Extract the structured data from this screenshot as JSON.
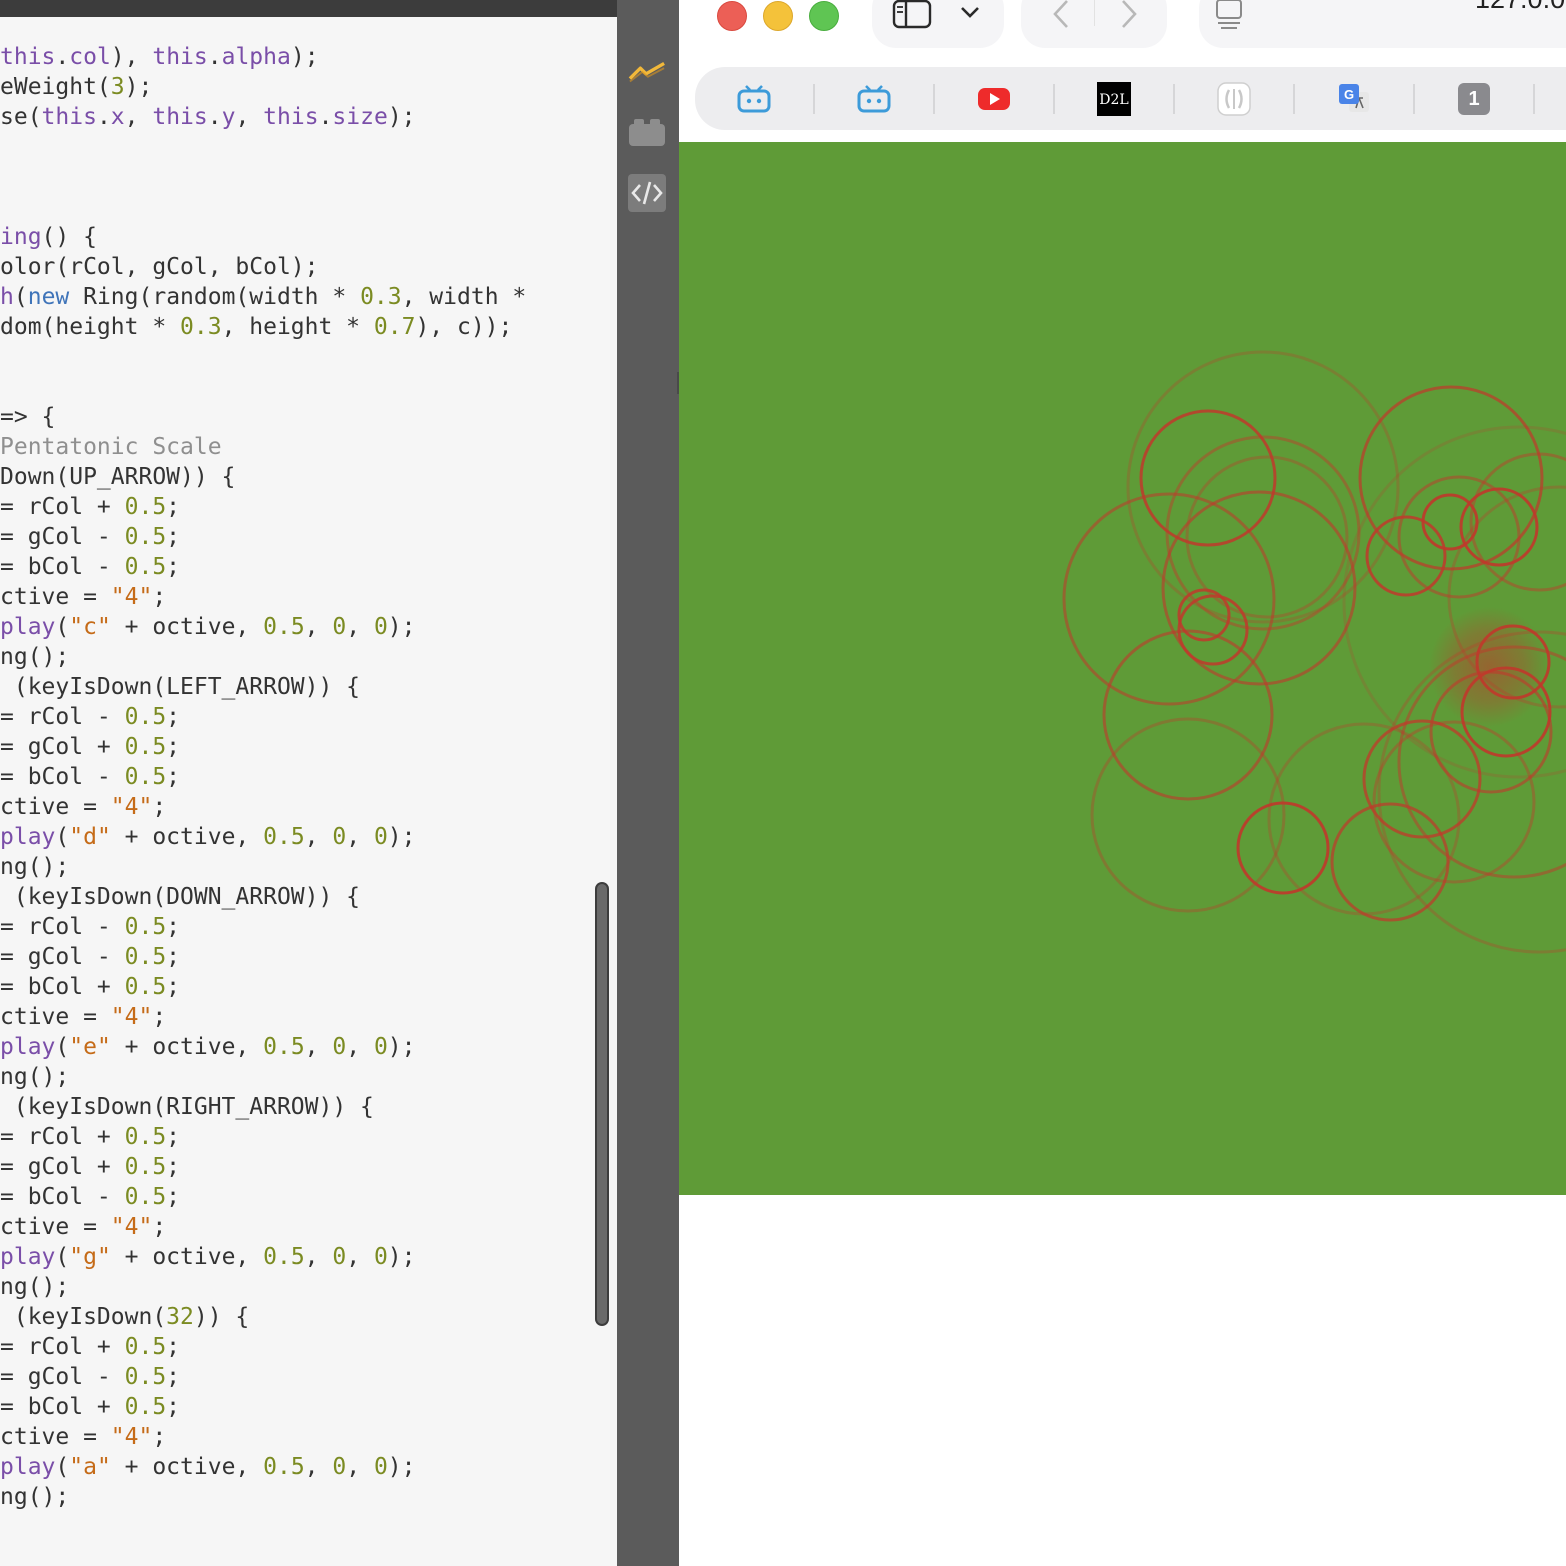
{
  "editor": {
    "lines": [
      {
        "tokens": [
          [
            "",
            ""
          ]
        ]
      },
      {
        "tokens": [
          [
            "prop",
            "this"
          ],
          [
            "",
            "."
          ],
          [
            "prop",
            "col"
          ],
          [
            "",
            "), "
          ],
          [
            "prop",
            "this"
          ],
          [
            "",
            "."
          ],
          [
            "prop",
            "alpha"
          ],
          [
            "",
            ");"
          ]
        ]
      },
      {
        "tokens": [
          [
            "",
            "eWeight("
          ],
          [
            "num",
            "3"
          ],
          [
            "",
            ");"
          ]
        ]
      },
      {
        "tokens": [
          [
            "",
            "se("
          ],
          [
            "prop",
            "this"
          ],
          [
            "",
            "."
          ],
          [
            "prop",
            "x"
          ],
          [
            "",
            ", "
          ],
          [
            "prop",
            "this"
          ],
          [
            "",
            "."
          ],
          [
            "prop",
            "y"
          ],
          [
            "",
            ", "
          ],
          [
            "prop",
            "this"
          ],
          [
            "",
            "."
          ],
          [
            "prop",
            "size"
          ],
          [
            "",
            ");"
          ]
        ]
      },
      {
        "tokens": [
          [
            "",
            ""
          ]
        ]
      },
      {
        "tokens": [
          [
            "",
            ""
          ]
        ]
      },
      {
        "tokens": [
          [
            "",
            ""
          ]
        ]
      },
      {
        "tokens": [
          [
            "prop",
            "ing"
          ],
          [
            "",
            "() {"
          ]
        ]
      },
      {
        "tokens": [
          [
            "",
            "olor(rCol, gCol, bCol);"
          ]
        ]
      },
      {
        "tokens": [
          [
            "prop",
            "h"
          ],
          [
            "",
            "("
          ],
          [
            "kw",
            "new"
          ],
          [
            "",
            " Ring(random(width * "
          ],
          [
            "num",
            "0.3"
          ],
          [
            "",
            ", width *"
          ]
        ]
      },
      {
        "tokens": [
          [
            "",
            "dom(height * "
          ],
          [
            "num",
            "0.3"
          ],
          [
            "",
            ", height * "
          ],
          [
            "num",
            "0.7"
          ],
          [
            "",
            "), c));"
          ]
        ]
      },
      {
        "tokens": [
          [
            "",
            ""
          ]
        ]
      },
      {
        "tokens": [
          [
            "",
            ""
          ]
        ]
      },
      {
        "tokens": [
          [
            "",
            "=> {"
          ]
        ]
      },
      {
        "tokens": [
          [
            "com",
            "Pentatonic Scale"
          ]
        ]
      },
      {
        "tokens": [
          [
            "",
            "Down(UP_ARROW)) {"
          ]
        ]
      },
      {
        "tokens": [
          [
            "",
            "= rCol + "
          ],
          [
            "num",
            "0.5"
          ],
          [
            "",
            ";"
          ]
        ]
      },
      {
        "tokens": [
          [
            "",
            "= gCol - "
          ],
          [
            "num",
            "0.5"
          ],
          [
            "",
            ";"
          ]
        ]
      },
      {
        "tokens": [
          [
            "",
            "= bCol - "
          ],
          [
            "num",
            "0.5"
          ],
          [
            "",
            ";"
          ]
        ]
      },
      {
        "tokens": [
          [
            "",
            "ctive = "
          ],
          [
            "str",
            "\"4\""
          ],
          [
            "",
            ";"
          ]
        ]
      },
      {
        "tokens": [
          [
            "prop",
            "play"
          ],
          [
            "",
            "("
          ],
          [
            "str",
            "\"c\""
          ],
          [
            "",
            " + octive, "
          ],
          [
            "num",
            "0.5"
          ],
          [
            "",
            ", "
          ],
          [
            "num",
            "0"
          ],
          [
            "",
            ", "
          ],
          [
            "num",
            "0"
          ],
          [
            "",
            ");"
          ]
        ]
      },
      {
        "tokens": [
          [
            "",
            "ng();"
          ]
        ]
      },
      {
        "tokens": [
          [
            "",
            " (keyIsDown(LEFT_ARROW)) {"
          ]
        ]
      },
      {
        "tokens": [
          [
            "",
            "= rCol - "
          ],
          [
            "num",
            "0.5"
          ],
          [
            "",
            ";"
          ]
        ]
      },
      {
        "tokens": [
          [
            "",
            "= gCol + "
          ],
          [
            "num",
            "0.5"
          ],
          [
            "",
            ";"
          ]
        ]
      },
      {
        "tokens": [
          [
            "",
            "= bCol - "
          ],
          [
            "num",
            "0.5"
          ],
          [
            "",
            ";"
          ]
        ]
      },
      {
        "tokens": [
          [
            "",
            "ctive = "
          ],
          [
            "str",
            "\"4\""
          ],
          [
            "",
            ";"
          ]
        ]
      },
      {
        "tokens": [
          [
            "prop",
            "play"
          ],
          [
            "",
            "("
          ],
          [
            "str",
            "\"d\""
          ],
          [
            "",
            " + octive, "
          ],
          [
            "num",
            "0.5"
          ],
          [
            "",
            ", "
          ],
          [
            "num",
            "0"
          ],
          [
            "",
            ", "
          ],
          [
            "num",
            "0"
          ],
          [
            "",
            ");"
          ]
        ]
      },
      {
        "tokens": [
          [
            "",
            "ng();"
          ]
        ]
      },
      {
        "tokens": [
          [
            "",
            " (keyIsDown(DOWN_ARROW)) {"
          ]
        ]
      },
      {
        "tokens": [
          [
            "",
            "= rCol - "
          ],
          [
            "num",
            "0.5"
          ],
          [
            "",
            ";"
          ]
        ]
      },
      {
        "tokens": [
          [
            "",
            "= gCol - "
          ],
          [
            "num",
            "0.5"
          ],
          [
            "",
            ";"
          ]
        ]
      },
      {
        "tokens": [
          [
            "",
            "= bCol + "
          ],
          [
            "num",
            "0.5"
          ],
          [
            "",
            ";"
          ]
        ]
      },
      {
        "tokens": [
          [
            "",
            "ctive = "
          ],
          [
            "str",
            "\"4\""
          ],
          [
            "",
            ";"
          ]
        ]
      },
      {
        "tokens": [
          [
            "prop",
            "play"
          ],
          [
            "",
            "("
          ],
          [
            "str",
            "\"e\""
          ],
          [
            "",
            " + octive, "
          ],
          [
            "num",
            "0.5"
          ],
          [
            "",
            ", "
          ],
          [
            "num",
            "0"
          ],
          [
            "",
            ", "
          ],
          [
            "num",
            "0"
          ],
          [
            "",
            ");"
          ]
        ]
      },
      {
        "tokens": [
          [
            "",
            "ng();"
          ]
        ]
      },
      {
        "tokens": [
          [
            "",
            " (keyIsDown(RIGHT_ARROW)) {"
          ]
        ]
      },
      {
        "tokens": [
          [
            "",
            "= rCol + "
          ],
          [
            "num",
            "0.5"
          ],
          [
            "",
            ";"
          ]
        ]
      },
      {
        "tokens": [
          [
            "",
            "= gCol + "
          ],
          [
            "num",
            "0.5"
          ],
          [
            "",
            ";"
          ]
        ]
      },
      {
        "tokens": [
          [
            "",
            "= bCol - "
          ],
          [
            "num",
            "0.5"
          ],
          [
            "",
            ";"
          ]
        ]
      },
      {
        "tokens": [
          [
            "",
            "ctive = "
          ],
          [
            "str",
            "\"4\""
          ],
          [
            "",
            ";"
          ]
        ]
      },
      {
        "tokens": [
          [
            "prop",
            "play"
          ],
          [
            "",
            "("
          ],
          [
            "str",
            "\"g\""
          ],
          [
            "",
            " + octive, "
          ],
          [
            "num",
            "0.5"
          ],
          [
            "",
            ", "
          ],
          [
            "num",
            "0"
          ],
          [
            "",
            ", "
          ],
          [
            "num",
            "0"
          ],
          [
            "",
            ");"
          ]
        ]
      },
      {
        "tokens": [
          [
            "",
            "ng();"
          ]
        ]
      },
      {
        "tokens": [
          [
            "",
            " (keyIsDown("
          ],
          [
            "num",
            "32"
          ],
          [
            "",
            ")) {"
          ]
        ]
      },
      {
        "tokens": [
          [
            "",
            "= rCol + "
          ],
          [
            "num",
            "0.5"
          ],
          [
            "",
            ";"
          ]
        ]
      },
      {
        "tokens": [
          [
            "",
            "= gCol - "
          ],
          [
            "num",
            "0.5"
          ],
          [
            "",
            ";"
          ]
        ]
      },
      {
        "tokens": [
          [
            "",
            "= bCol + "
          ],
          [
            "num",
            "0.5"
          ],
          [
            "",
            ";"
          ]
        ]
      },
      {
        "tokens": [
          [
            "",
            "ctive = "
          ],
          [
            "str",
            "\"4\""
          ],
          [
            "",
            ";"
          ]
        ]
      },
      {
        "tokens": [
          [
            "prop",
            "play"
          ],
          [
            "",
            "("
          ],
          [
            "str",
            "\"a\""
          ],
          [
            "",
            " + octive, "
          ],
          [
            "num",
            "0.5"
          ],
          [
            "",
            ", "
          ],
          [
            "num",
            "0"
          ],
          [
            "",
            ", "
          ],
          [
            "num",
            "0"
          ],
          [
            "",
            ");"
          ]
        ]
      },
      {
        "tokens": [
          [
            "",
            "ng();"
          ]
        ]
      }
    ]
  },
  "side_toolbar": {
    "tools": [
      {
        "name": "sketch-icon"
      },
      {
        "name": "library-icon"
      },
      {
        "name": "code-icon"
      }
    ]
  },
  "browser": {
    "address": "127.0.0.",
    "bookmarks": [
      {
        "icon": "bilibili-icon"
      },
      {
        "icon": "bilibili-icon"
      },
      {
        "icon": "youtube-icon"
      },
      {
        "icon": "d2l-icon",
        "label": "D2L"
      },
      {
        "icon": "app-icon"
      },
      {
        "icon": "google-translate-icon",
        "label": "G"
      },
      {
        "icon": "tab-count-badge",
        "label": "1"
      }
    ]
  },
  "colors": {
    "canvas_bg": "#5f9b37",
    "ring": "#c0392b",
    "editor_bg": "#f6f6f6",
    "toolbar_bg": "#5b5b5b"
  }
}
